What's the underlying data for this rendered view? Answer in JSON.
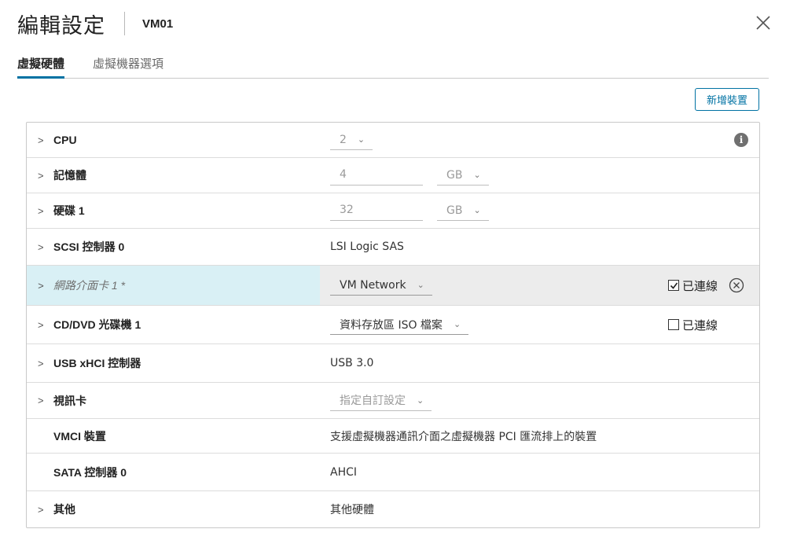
{
  "dialog": {
    "title": "編輯設定",
    "vm_name": "VM01"
  },
  "tabs": [
    {
      "label": "虛擬硬體",
      "active": true
    },
    {
      "label": "虛擬機器選項",
      "active": false
    }
  ],
  "toolbar": {
    "add_device_label": "新增裝置"
  },
  "rows": {
    "cpu": {
      "label": "CPU",
      "value": "2"
    },
    "memory": {
      "label": "記憶體",
      "value": "4",
      "unit": "GB"
    },
    "disk": {
      "label": "硬碟 1",
      "value": "32",
      "unit": "GB"
    },
    "scsi": {
      "label": "SCSI 控制器 0",
      "value": "LSI Logic SAS"
    },
    "nic": {
      "label": "網路介面卡 1 *",
      "value": "VM Network",
      "connected_label": "已連線",
      "connected": true
    },
    "cdrom": {
      "label": "CD/DVD 光碟機 1",
      "value": "資料存放區 ISO 檔案",
      "connected_label": "已連線",
      "connected": false
    },
    "usb": {
      "label": "USB xHCI 控制器",
      "value": "USB 3.0"
    },
    "video": {
      "label": "視訊卡",
      "value": "指定自訂設定"
    },
    "vmci": {
      "label": "VMCI 裝置",
      "value": "支援虛擬機器通訊介面之虛擬機器 PCI 匯流排上的裝置"
    },
    "sata": {
      "label": "SATA 控制器 0",
      "value": "AHCI"
    },
    "other": {
      "label": "其他",
      "value": "其他硬體"
    }
  },
  "colors": {
    "accent": "#0072a3",
    "highlight_label_bg": "#d9f0f5",
    "highlight_row_bg": "#ececec"
  },
  "icons": [
    "close-icon",
    "chevron-right-icon",
    "chevron-down-icon",
    "info-icon",
    "checkbox-icon",
    "remove-circle-icon"
  ]
}
